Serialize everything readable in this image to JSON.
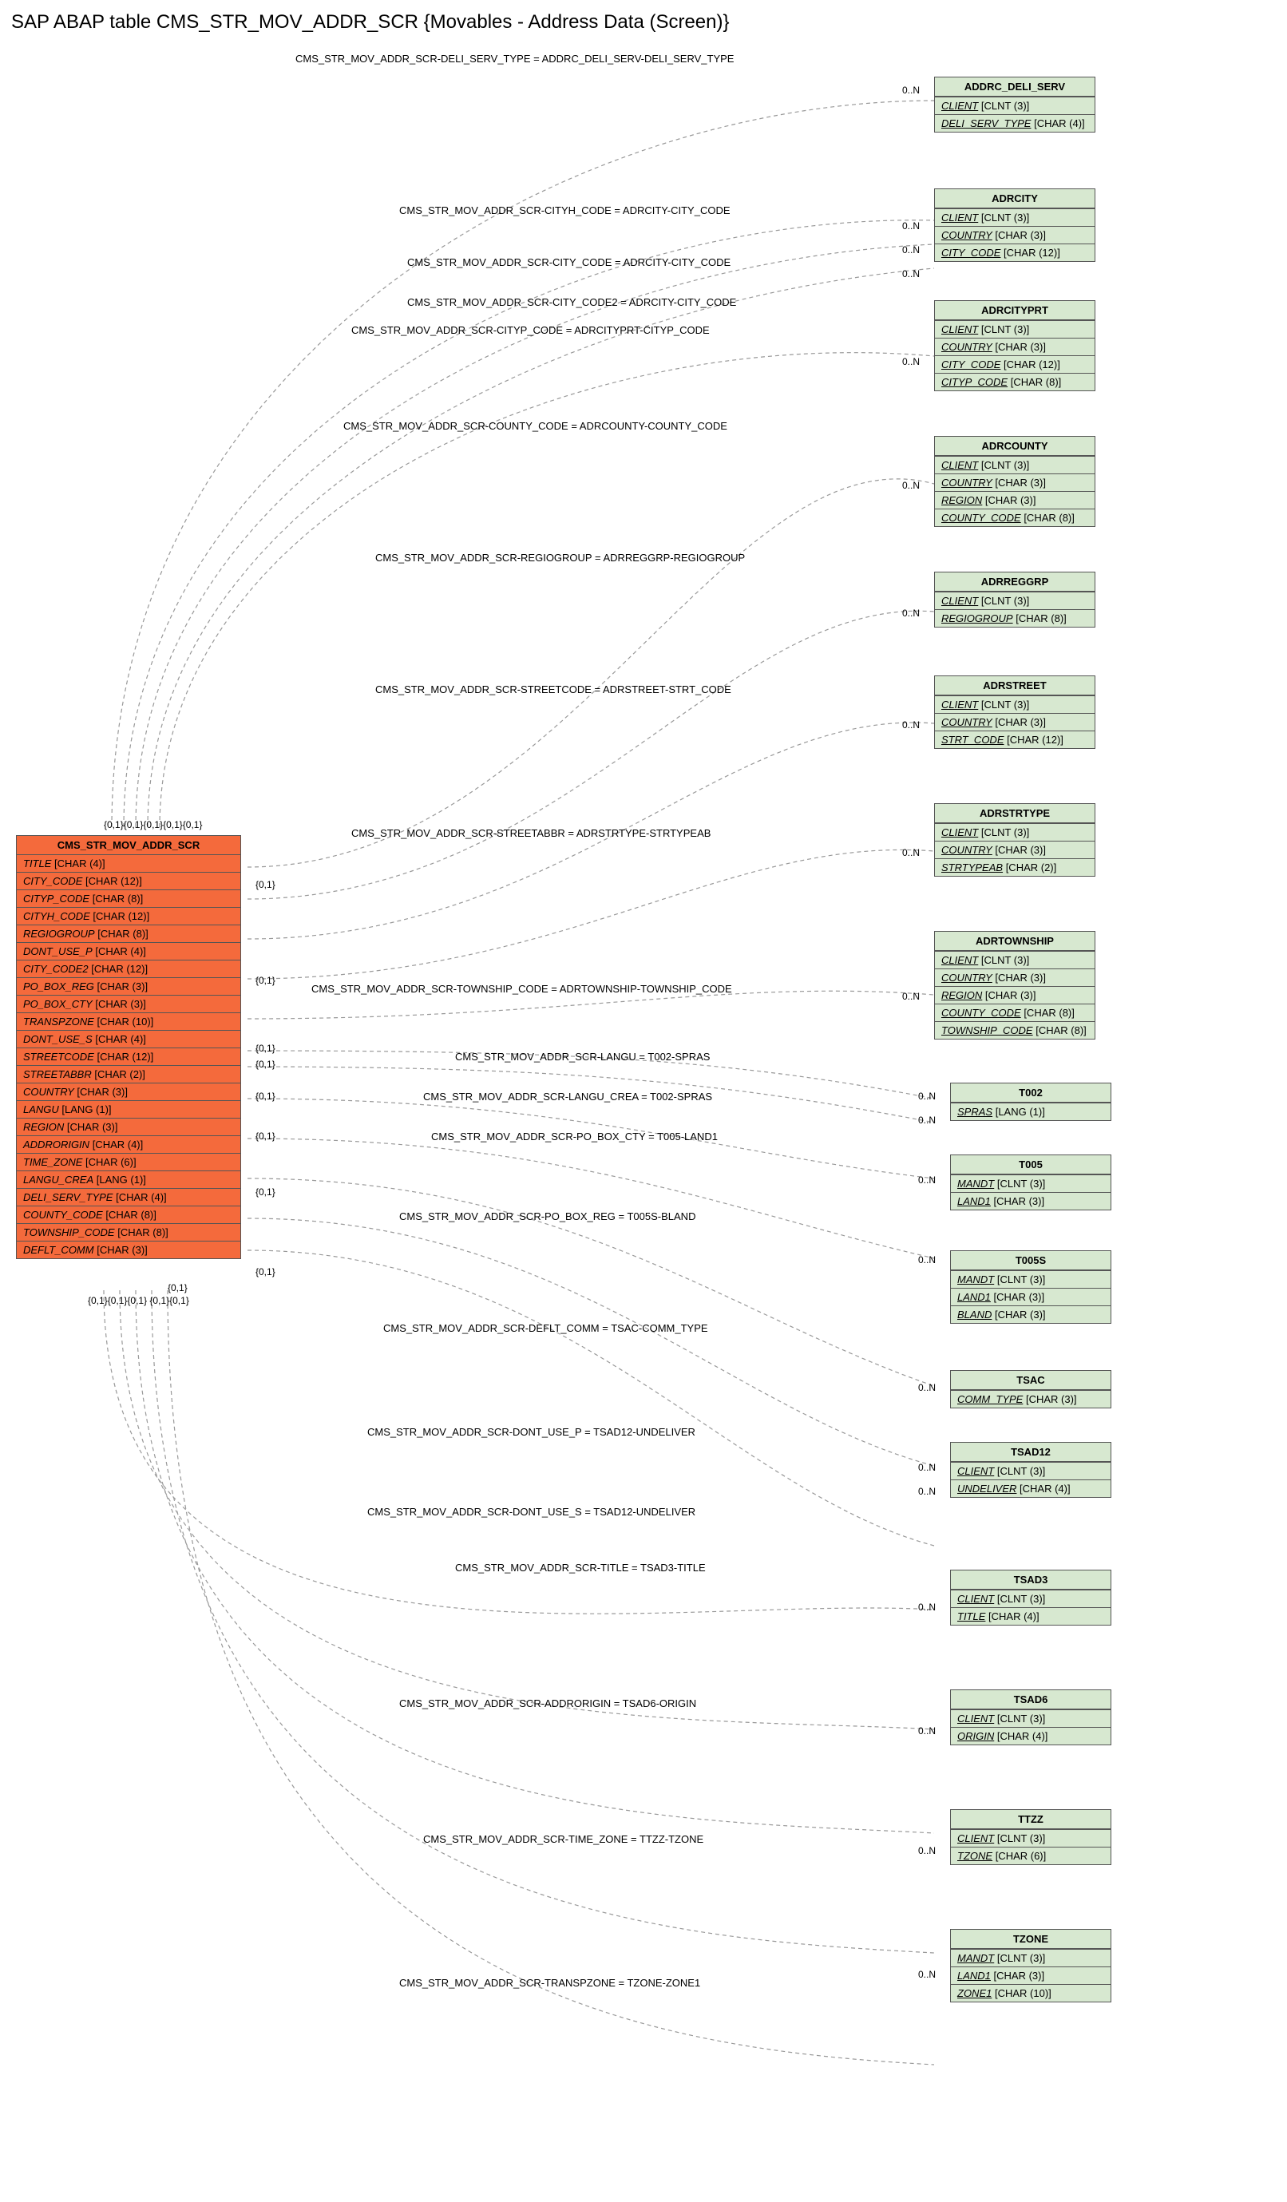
{
  "title": "SAP ABAP table CMS_STR_MOV_ADDR_SCR {Movables - Address Data (Screen)}",
  "main": {
    "name": "CMS_STR_MOV_ADDR_SCR",
    "fields": [
      {
        "name": "TITLE",
        "type": "[CHAR (4)]"
      },
      {
        "name": "CITY_CODE",
        "type": "[CHAR (12)]"
      },
      {
        "name": "CITYP_CODE",
        "type": "[CHAR (8)]"
      },
      {
        "name": "CITYH_CODE",
        "type": "[CHAR (12)]"
      },
      {
        "name": "REGIOGROUP",
        "type": "[CHAR (8)]"
      },
      {
        "name": "DONT_USE_P",
        "type": "[CHAR (4)]"
      },
      {
        "name": "CITY_CODE2",
        "type": "[CHAR (12)]"
      },
      {
        "name": "PO_BOX_REG",
        "type": "[CHAR (3)]"
      },
      {
        "name": "PO_BOX_CTY",
        "type": "[CHAR (3)]"
      },
      {
        "name": "TRANSPZONE",
        "type": "[CHAR (10)]"
      },
      {
        "name": "DONT_USE_S",
        "type": "[CHAR (4)]"
      },
      {
        "name": "STREETCODE",
        "type": "[CHAR (12)]"
      },
      {
        "name": "STREETABBR",
        "type": "[CHAR (2)]"
      },
      {
        "name": "COUNTRY",
        "type": "[CHAR (3)]"
      },
      {
        "name": "LANGU",
        "type": "[LANG (1)]"
      },
      {
        "name": "REGION",
        "type": "[CHAR (3)]"
      },
      {
        "name": "ADDRORIGIN",
        "type": "[CHAR (4)]"
      },
      {
        "name": "TIME_ZONE",
        "type": "[CHAR (6)]"
      },
      {
        "name": "LANGU_CREA",
        "type": "[LANG (1)]"
      },
      {
        "name": "DELI_SERV_TYPE",
        "type": "[CHAR (4)]"
      },
      {
        "name": "COUNTY_CODE",
        "type": "[CHAR (8)]"
      },
      {
        "name": "TOWNSHIP_CODE",
        "type": "[CHAR (8)]"
      },
      {
        "name": "DEFLT_COMM",
        "type": "[CHAR (3)]"
      }
    ]
  },
  "targets": [
    {
      "id": "addrc_deli_serv",
      "name": "ADDRC_DELI_SERV",
      "fields": [
        {
          "name": "CLIENT",
          "type": "[CLNT (3)]",
          "u": true
        },
        {
          "name": "DELI_SERV_TYPE",
          "type": "[CHAR (4)]",
          "u": true
        }
      ]
    },
    {
      "id": "adrcity",
      "name": "ADRCITY",
      "fields": [
        {
          "name": "CLIENT",
          "type": "[CLNT (3)]",
          "u": true
        },
        {
          "name": "COUNTRY",
          "type": "[CHAR (3)]",
          "u": true
        },
        {
          "name": "CITY_CODE",
          "type": "[CHAR (12)]",
          "u": true
        }
      ]
    },
    {
      "id": "adrcityprt",
      "name": "ADRCITYPRT",
      "fields": [
        {
          "name": "CLIENT",
          "type": "[CLNT (3)]",
          "u": true
        },
        {
          "name": "COUNTRY",
          "type": "[CHAR (3)]",
          "u": true
        },
        {
          "name": "CITY_CODE",
          "type": "[CHAR (12)]",
          "u": true
        },
        {
          "name": "CITYP_CODE",
          "type": "[CHAR (8)]",
          "u": true
        }
      ]
    },
    {
      "id": "adrcounty",
      "name": "ADRCOUNTY",
      "fields": [
        {
          "name": "CLIENT",
          "type": "[CLNT (3)]",
          "u": true
        },
        {
          "name": "COUNTRY",
          "type": "[CHAR (3)]",
          "u": true
        },
        {
          "name": "REGION",
          "type": "[CHAR (3)]",
          "u": true
        },
        {
          "name": "COUNTY_CODE",
          "type": "[CHAR (8)]",
          "u": true
        }
      ]
    },
    {
      "id": "adrreggrp",
      "name": "ADRREGGRP",
      "fields": [
        {
          "name": "CLIENT",
          "type": "[CLNT (3)]",
          "u": true
        },
        {
          "name": "REGIOGROUP",
          "type": "[CHAR (8)]",
          "u": true
        }
      ]
    },
    {
      "id": "adrstreet",
      "name": "ADRSTREET",
      "fields": [
        {
          "name": "CLIENT",
          "type": "[CLNT (3)]",
          "u": true
        },
        {
          "name": "COUNTRY",
          "type": "[CHAR (3)]",
          "u": true
        },
        {
          "name": "STRT_CODE",
          "type": "[CHAR (12)]",
          "u": true
        }
      ]
    },
    {
      "id": "adrstrtype",
      "name": "ADRSTRTYPE",
      "fields": [
        {
          "name": "CLIENT",
          "type": "[CLNT (3)]",
          "u": true
        },
        {
          "name": "COUNTRY",
          "type": "[CHAR (3)]",
          "u": true
        },
        {
          "name": "STRTYPEAB",
          "type": "[CHAR (2)]",
          "u": true
        }
      ]
    },
    {
      "id": "adrtownship",
      "name": "ADRTOWNSHIP",
      "fields": [
        {
          "name": "CLIENT",
          "type": "[CLNT (3)]",
          "u": true
        },
        {
          "name": "COUNTRY",
          "type": "[CHAR (3)]",
          "u": true
        },
        {
          "name": "REGION",
          "type": "[CHAR (3)]",
          "u": true
        },
        {
          "name": "COUNTY_CODE",
          "type": "[CHAR (8)]",
          "u": true
        },
        {
          "name": "TOWNSHIP_CODE",
          "type": "[CHAR (8)]",
          "u": true
        }
      ]
    },
    {
      "id": "t002",
      "name": "T002",
      "fields": [
        {
          "name": "SPRAS",
          "type": "[LANG (1)]",
          "u": true
        }
      ]
    },
    {
      "id": "t005",
      "name": "T005",
      "fields": [
        {
          "name": "MANDT",
          "type": "[CLNT (3)]",
          "u": true
        },
        {
          "name": "LAND1",
          "type": "[CHAR (3)]",
          "u": true
        }
      ]
    },
    {
      "id": "t005s",
      "name": "T005S",
      "fields": [
        {
          "name": "MANDT",
          "type": "[CLNT (3)]",
          "u": true
        },
        {
          "name": "LAND1",
          "type": "[CHAR (3)]",
          "u": true
        },
        {
          "name": "BLAND",
          "type": "[CHAR (3)]",
          "u": true
        }
      ]
    },
    {
      "id": "tsac",
      "name": "TSAC",
      "fields": [
        {
          "name": "COMM_TYPE",
          "type": "[CHAR (3)]",
          "u": true
        }
      ]
    },
    {
      "id": "tsad12",
      "name": "TSAD12",
      "fields": [
        {
          "name": "CLIENT",
          "type": "[CLNT (3)]",
          "u": true
        },
        {
          "name": "UNDELIVER",
          "type": "[CHAR (4)]",
          "u": true
        }
      ]
    },
    {
      "id": "tsad3",
      "name": "TSAD3",
      "fields": [
        {
          "name": "CLIENT",
          "type": "[CLNT (3)]",
          "u": true
        },
        {
          "name": "TITLE",
          "type": "[CHAR (4)]",
          "u": true
        }
      ]
    },
    {
      "id": "tsad6",
      "name": "TSAD6",
      "fields": [
        {
          "name": "CLIENT",
          "type": "[CLNT (3)]",
          "u": true
        },
        {
          "name": "ORIGIN",
          "type": "[CHAR (4)]",
          "u": true
        }
      ]
    },
    {
      "id": "ttzz",
      "name": "TTZZ",
      "fields": [
        {
          "name": "CLIENT",
          "type": "[CLNT (3)]",
          "u": true
        },
        {
          "name": "TZONE",
          "type": "[CHAR (6)]",
          "u": true
        }
      ]
    },
    {
      "id": "tzone",
      "name": "TZONE",
      "fields": [
        {
          "name": "MANDT",
          "type": "[CLNT (3)]",
          "u": true
        },
        {
          "name": "LAND1",
          "type": "[CHAR (3)]",
          "u": true
        },
        {
          "name": "ZONE1",
          "type": "[CHAR (10)]",
          "u": true
        }
      ]
    }
  ],
  "relations": [
    {
      "label": "CMS_STR_MOV_ADDR_SCR-DELI_SERV_TYPE = ADDRC_DELI_SERV-DELI_SERV_TYPE",
      "target": "addrc_deli_serv"
    },
    {
      "label": "CMS_STR_MOV_ADDR_SCR-CITYH_CODE = ADRCITY-CITY_CODE",
      "target": "adrcity"
    },
    {
      "label": "CMS_STR_MOV_ADDR_SCR-CITY_CODE = ADRCITY-CITY_CODE",
      "target": "adrcity"
    },
    {
      "label": "CMS_STR_MOV_ADDR_SCR-CITY_CODE2 = ADRCITY-CITY_CODE",
      "target": "adrcity"
    },
    {
      "label": "CMS_STR_MOV_ADDR_SCR-CITYP_CODE = ADRCITYPRT-CITYP_CODE",
      "target": "adrcityprt"
    },
    {
      "label": "CMS_STR_MOV_ADDR_SCR-COUNTY_CODE = ADRCOUNTY-COUNTY_CODE",
      "target": "adrcounty"
    },
    {
      "label": "CMS_STR_MOV_ADDR_SCR-REGIOGROUP = ADRREGGRP-REGIOGROUP",
      "target": "adrreggrp"
    },
    {
      "label": "CMS_STR_MOV_ADDR_SCR-STREETCODE = ADRSTREET-STRT_CODE",
      "target": "adrstreet"
    },
    {
      "label": "CMS_STR_MOV_ADDR_SCR-STREETABBR = ADRSTRTYPE-STRTYPEAB",
      "target": "adrstrtype"
    },
    {
      "label": "CMS_STR_MOV_ADDR_SCR-TOWNSHIP_CODE = ADRTOWNSHIP-TOWNSHIP_CODE",
      "target": "adrtownship"
    },
    {
      "label": "CMS_STR_MOV_ADDR_SCR-LANGU = T002-SPRAS",
      "target": "t002"
    },
    {
      "label": "CMS_STR_MOV_ADDR_SCR-LANGU_CREA = T002-SPRAS",
      "target": "t002"
    },
    {
      "label": "CMS_STR_MOV_ADDR_SCR-PO_BOX_CTY = T005-LAND1",
      "target": "t005"
    },
    {
      "label": "CMS_STR_MOV_ADDR_SCR-PO_BOX_REG = T005S-BLAND",
      "target": "t005s"
    },
    {
      "label": "CMS_STR_MOV_ADDR_SCR-DEFLT_COMM = TSAC-COMM_TYPE",
      "target": "tsac"
    },
    {
      "label": "CMS_STR_MOV_ADDR_SCR-DONT_USE_P = TSAD12-UNDELIVER",
      "target": "tsad12"
    },
    {
      "label": "CMS_STR_MOV_ADDR_SCR-DONT_USE_S = TSAD12-UNDELIVER",
      "target": "tsad12"
    },
    {
      "label": "CMS_STR_MOV_ADDR_SCR-TITLE = TSAD3-TITLE",
      "target": "tsad3"
    },
    {
      "label": "CMS_STR_MOV_ADDR_SCR-ADDRORIGIN = TSAD6-ORIGIN",
      "target": "tsad6"
    },
    {
      "label": "CMS_STR_MOV_ADDR_SCR-TIME_ZONE = TTZZ-TZONE",
      "target": "ttzz"
    },
    {
      "label": "CMS_STR_MOV_ADDR_SCR-TRANSPZONE = TZONE-ZONE1",
      "target": "tzone"
    }
  ],
  "cards": {
    "top_cluster": "{0,1}{0,1}{0,1}{0,1}{0,1}",
    "bot_cluster": "{0,1}{0,1}{0,1}   {0,1}{0,1}",
    "left_01": "{0,1}",
    "right_0n": "0..N"
  }
}
